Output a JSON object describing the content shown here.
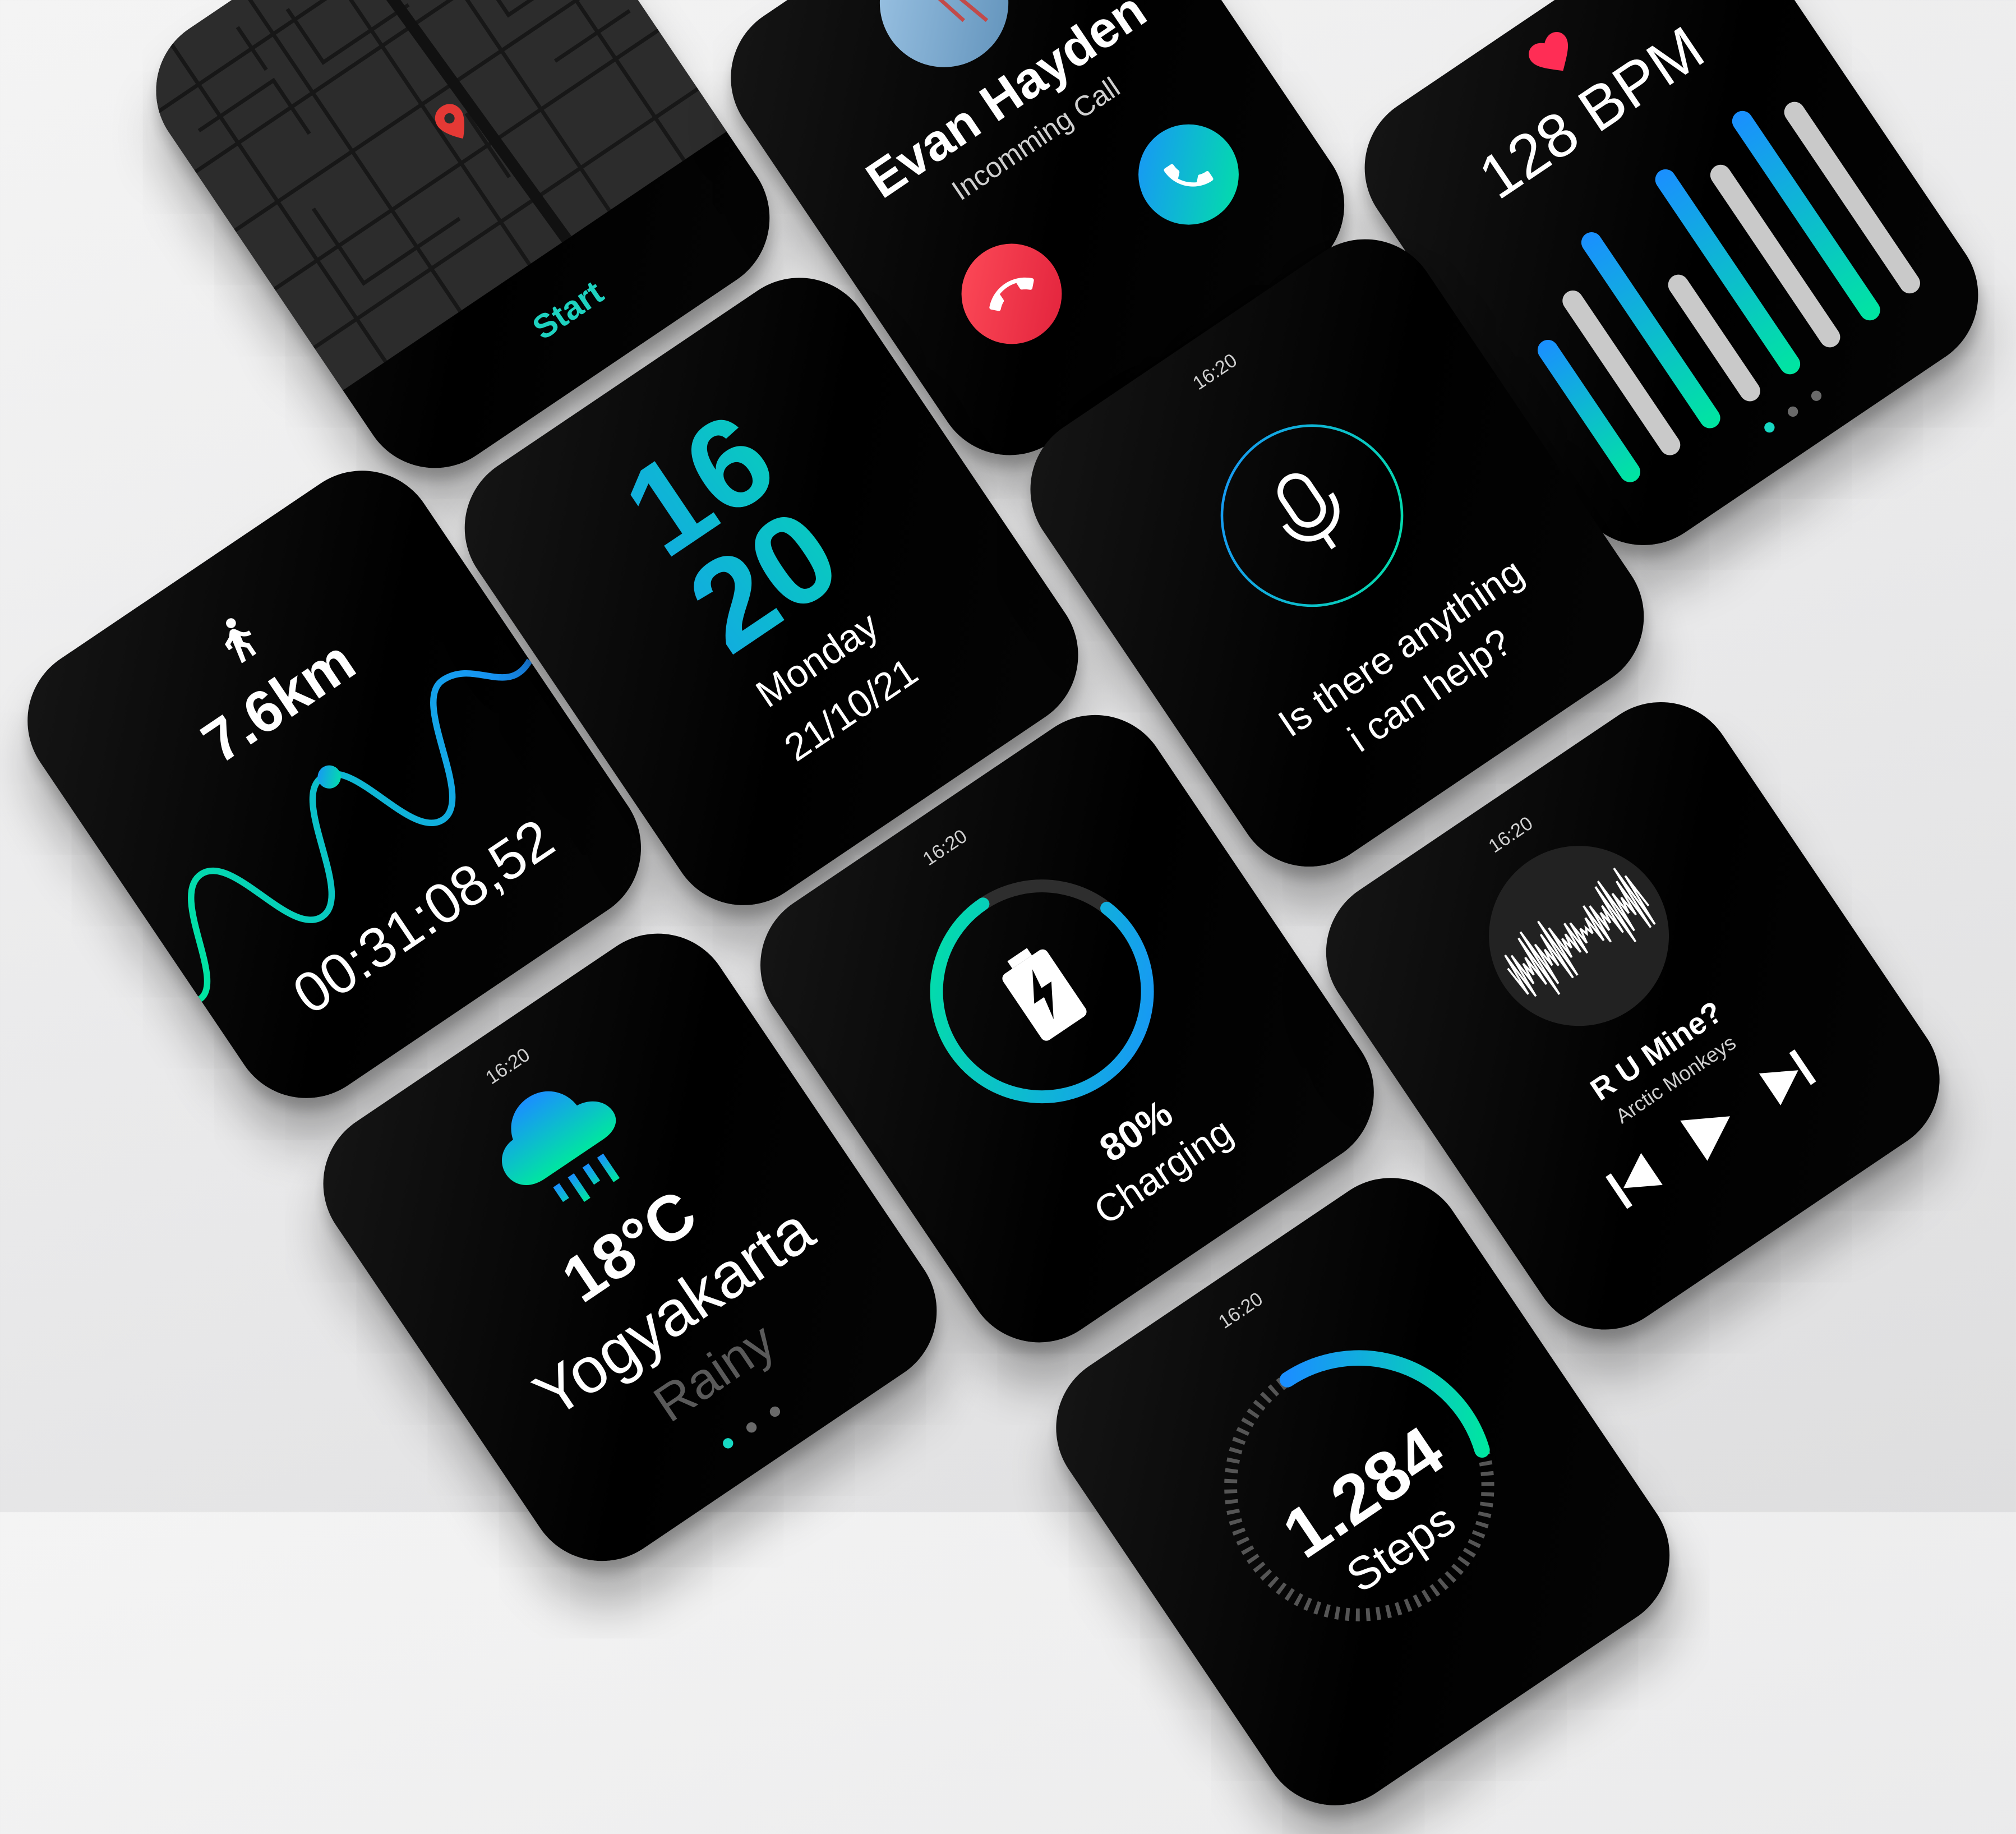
{
  "navigation": {
    "start_label": "Start"
  },
  "call": {
    "caller": "Evan Hayden",
    "status": "Incomming Call"
  },
  "heart": {
    "bpm": "128 BPM",
    "bars": [
      0.62,
      0.72,
      0.86,
      0.55,
      0.9,
      0.8,
      0.92,
      0.84
    ]
  },
  "workout": {
    "distance": "7.6km",
    "elapsed": "00:31:08,52"
  },
  "clock": {
    "hour": "16",
    "minute": "20",
    "day": "Monday",
    "date": "21/10/21"
  },
  "assistant": {
    "time": "16:20",
    "prompt_pre": "Is there ",
    "prompt_bold": "anything",
    "prompt_post": "i can help?"
  },
  "battery": {
    "time": "16:20",
    "percent": "80%",
    "status": "Charging",
    "level": 0.8
  },
  "music": {
    "time": "16:20",
    "title": "R U Mine?",
    "artist": "Arctic Monkeys"
  },
  "weather": {
    "time": "16:20",
    "temperature": "18°C",
    "city": "Yogyakarta",
    "condition": "Rainy"
  },
  "steps": {
    "time": "16:20",
    "count": "1.284",
    "label": "Steps"
  },
  "colors": {
    "accent_start": "#1a8fff",
    "accent_end": "#00e6a0",
    "decline": "#f0383e",
    "pin": "#e53935",
    "heart": "#ff2d55"
  },
  "icons": [
    "map-pin-icon",
    "phone-icon",
    "decline-call-icon",
    "heart-icon",
    "running-icon",
    "microphone-icon",
    "battery-charging-icon",
    "previous-track-icon",
    "play-icon",
    "next-track-icon",
    "rain-cloud-icon"
  ]
}
